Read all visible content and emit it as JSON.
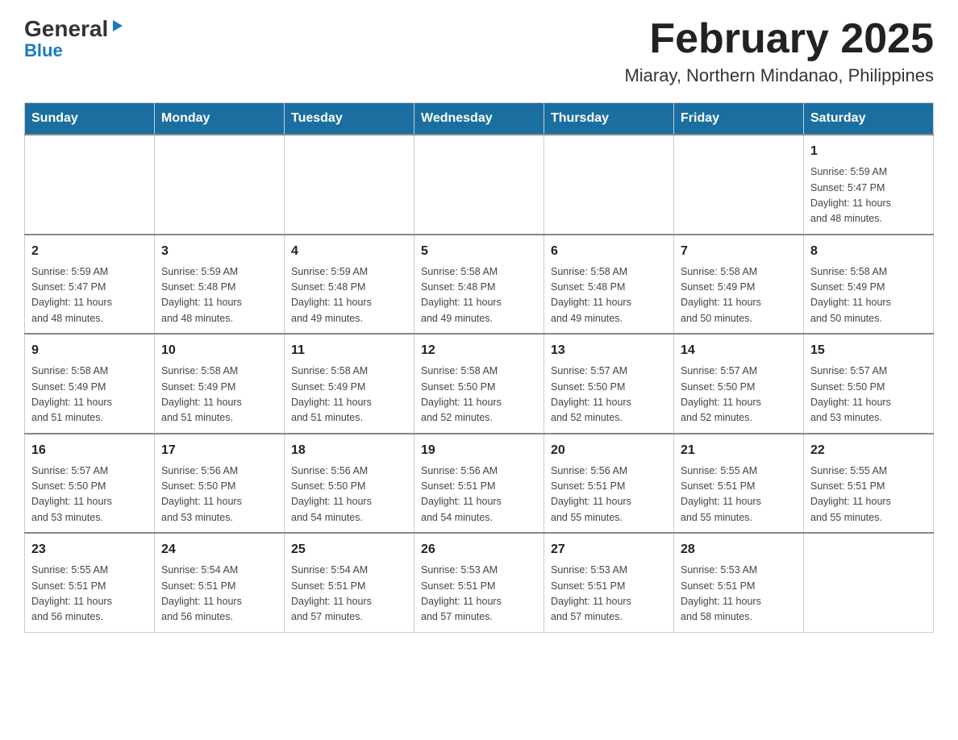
{
  "header": {
    "logo_general": "General",
    "logo_blue": "Blue",
    "title": "February 2025",
    "subtitle": "Miaray, Northern Mindanao, Philippines"
  },
  "calendar": {
    "days_of_week": [
      "Sunday",
      "Monday",
      "Tuesday",
      "Wednesday",
      "Thursday",
      "Friday",
      "Saturday"
    ],
    "weeks": [
      [
        {
          "day": "",
          "info": ""
        },
        {
          "day": "",
          "info": ""
        },
        {
          "day": "",
          "info": ""
        },
        {
          "day": "",
          "info": ""
        },
        {
          "day": "",
          "info": ""
        },
        {
          "day": "",
          "info": ""
        },
        {
          "day": "1",
          "info": "Sunrise: 5:59 AM\nSunset: 5:47 PM\nDaylight: 11 hours\nand 48 minutes."
        }
      ],
      [
        {
          "day": "2",
          "info": "Sunrise: 5:59 AM\nSunset: 5:47 PM\nDaylight: 11 hours\nand 48 minutes."
        },
        {
          "day": "3",
          "info": "Sunrise: 5:59 AM\nSunset: 5:48 PM\nDaylight: 11 hours\nand 48 minutes."
        },
        {
          "day": "4",
          "info": "Sunrise: 5:59 AM\nSunset: 5:48 PM\nDaylight: 11 hours\nand 49 minutes."
        },
        {
          "day": "5",
          "info": "Sunrise: 5:58 AM\nSunset: 5:48 PM\nDaylight: 11 hours\nand 49 minutes."
        },
        {
          "day": "6",
          "info": "Sunrise: 5:58 AM\nSunset: 5:48 PM\nDaylight: 11 hours\nand 49 minutes."
        },
        {
          "day": "7",
          "info": "Sunrise: 5:58 AM\nSunset: 5:49 PM\nDaylight: 11 hours\nand 50 minutes."
        },
        {
          "day": "8",
          "info": "Sunrise: 5:58 AM\nSunset: 5:49 PM\nDaylight: 11 hours\nand 50 minutes."
        }
      ],
      [
        {
          "day": "9",
          "info": "Sunrise: 5:58 AM\nSunset: 5:49 PM\nDaylight: 11 hours\nand 51 minutes."
        },
        {
          "day": "10",
          "info": "Sunrise: 5:58 AM\nSunset: 5:49 PM\nDaylight: 11 hours\nand 51 minutes."
        },
        {
          "day": "11",
          "info": "Sunrise: 5:58 AM\nSunset: 5:49 PM\nDaylight: 11 hours\nand 51 minutes."
        },
        {
          "day": "12",
          "info": "Sunrise: 5:58 AM\nSunset: 5:50 PM\nDaylight: 11 hours\nand 52 minutes."
        },
        {
          "day": "13",
          "info": "Sunrise: 5:57 AM\nSunset: 5:50 PM\nDaylight: 11 hours\nand 52 minutes."
        },
        {
          "day": "14",
          "info": "Sunrise: 5:57 AM\nSunset: 5:50 PM\nDaylight: 11 hours\nand 52 minutes."
        },
        {
          "day": "15",
          "info": "Sunrise: 5:57 AM\nSunset: 5:50 PM\nDaylight: 11 hours\nand 53 minutes."
        }
      ],
      [
        {
          "day": "16",
          "info": "Sunrise: 5:57 AM\nSunset: 5:50 PM\nDaylight: 11 hours\nand 53 minutes."
        },
        {
          "day": "17",
          "info": "Sunrise: 5:56 AM\nSunset: 5:50 PM\nDaylight: 11 hours\nand 53 minutes."
        },
        {
          "day": "18",
          "info": "Sunrise: 5:56 AM\nSunset: 5:50 PM\nDaylight: 11 hours\nand 54 minutes."
        },
        {
          "day": "19",
          "info": "Sunrise: 5:56 AM\nSunset: 5:51 PM\nDaylight: 11 hours\nand 54 minutes."
        },
        {
          "day": "20",
          "info": "Sunrise: 5:56 AM\nSunset: 5:51 PM\nDaylight: 11 hours\nand 55 minutes."
        },
        {
          "day": "21",
          "info": "Sunrise: 5:55 AM\nSunset: 5:51 PM\nDaylight: 11 hours\nand 55 minutes."
        },
        {
          "day": "22",
          "info": "Sunrise: 5:55 AM\nSunset: 5:51 PM\nDaylight: 11 hours\nand 55 minutes."
        }
      ],
      [
        {
          "day": "23",
          "info": "Sunrise: 5:55 AM\nSunset: 5:51 PM\nDaylight: 11 hours\nand 56 minutes."
        },
        {
          "day": "24",
          "info": "Sunrise: 5:54 AM\nSunset: 5:51 PM\nDaylight: 11 hours\nand 56 minutes."
        },
        {
          "day": "25",
          "info": "Sunrise: 5:54 AM\nSunset: 5:51 PM\nDaylight: 11 hours\nand 57 minutes."
        },
        {
          "day": "26",
          "info": "Sunrise: 5:53 AM\nSunset: 5:51 PM\nDaylight: 11 hours\nand 57 minutes."
        },
        {
          "day": "27",
          "info": "Sunrise: 5:53 AM\nSunset: 5:51 PM\nDaylight: 11 hours\nand 57 minutes."
        },
        {
          "day": "28",
          "info": "Sunrise: 5:53 AM\nSunset: 5:51 PM\nDaylight: 11 hours\nand 58 minutes."
        },
        {
          "day": "",
          "info": ""
        }
      ]
    ]
  }
}
